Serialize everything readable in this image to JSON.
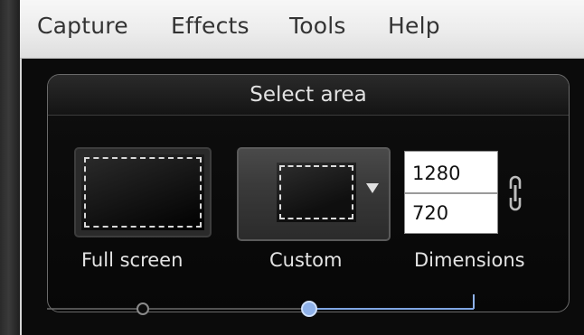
{
  "menubar": {
    "items": [
      "Capture",
      "Effects",
      "Tools",
      "Help"
    ]
  },
  "panel": {
    "title": "Select area"
  },
  "options": {
    "full_screen_label": "Full screen",
    "custom_label": "Custom",
    "dimensions_label": "Dimensions"
  },
  "dimensions": {
    "width": "1280",
    "height": "720"
  },
  "slider": {
    "selected_index": 1,
    "stop_count": 3
  },
  "colors": {
    "accent": "#7fa6e3",
    "menubar": "#ececec",
    "panel_bg": "#0b0b0b",
    "text": "#e2e2e2"
  },
  "icons": {
    "lock": "link-lock-icon",
    "dropdown": "chevron-down-icon"
  }
}
